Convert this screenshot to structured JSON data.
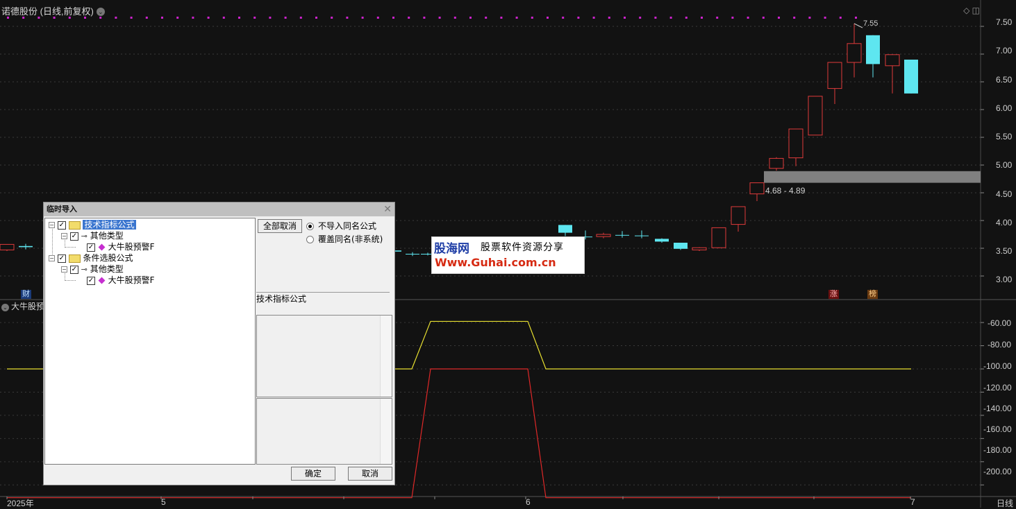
{
  "stock": {
    "title": "诺德股份 (日线,前复权)",
    "dropdown_glyph": "⌄"
  },
  "top_icons": [
    "◇",
    "◫"
  ],
  "price_axis": [
    "7.50",
    "7.00",
    "6.50",
    "6.00",
    "5.50",
    "5.00",
    "4.50",
    "4.00",
    "3.50",
    "3.00"
  ],
  "indicator": {
    "title": "大牛股预"
  },
  "indicator_axis": [
    "-60.00",
    "-80.00",
    "-100.00",
    "-120.00",
    "-140.00",
    "-160.00",
    "-180.00",
    "-200.00"
  ],
  "x_axis": {
    "labels": [
      "2025年",
      "5",
      "6",
      "7"
    ],
    "period": "日线"
  },
  "badges": {
    "cai": "财",
    "zhang": "涨",
    "bang": "榜"
  },
  "annotations": {
    "peak": "7.55",
    "range": "4.68 - 4.89"
  },
  "colors": {
    "up": "#e03a3a",
    "down": "#5ee6f0",
    "yellow_line": "#e8e030",
    "red_line": "#e02828",
    "magenta_dots": "#cc22cc",
    "band": "#808080"
  },
  "chart_data": {
    "type": "candlestick",
    "price_range": [
      2.75,
      7.75
    ],
    "candles": [
      {
        "o": 3.47,
        "c": 3.57,
        "h": 3.57,
        "l": 3.45,
        "dir": "up"
      },
      {
        "o": 3.54,
        "c": 3.52,
        "h": 3.58,
        "l": 3.48,
        "dir": "down"
      },
      {
        "o": 3.44,
        "c": 3.46,
        "h": 3.46,
        "l": 3.4,
        "dir": "down"
      },
      {
        "o": 3.4,
        "c": 3.39,
        "h": 3.43,
        "l": 3.36,
        "dir": "down"
      },
      {
        "o": 3.4,
        "c": 3.39,
        "h": 3.42,
        "l": 3.37,
        "dir": "down"
      },
      {
        "o": 3.92,
        "c": 3.78,
        "h": 3.92,
        "l": 3.72,
        "dir": "down"
      },
      {
        "o": 3.71,
        "c": 3.7,
        "h": 3.82,
        "l": 3.66,
        "dir": "down"
      },
      {
        "o": 3.71,
        "c": 3.75,
        "h": 3.78,
        "l": 3.68,
        "dir": "up"
      },
      {
        "o": 3.74,
        "c": 3.73,
        "h": 3.81,
        "l": 3.69,
        "dir": "down"
      },
      {
        "o": 3.73,
        "c": 3.72,
        "h": 3.82,
        "l": 3.68,
        "dir": "down"
      },
      {
        "o": 3.67,
        "c": 3.62,
        "h": 3.68,
        "l": 3.6,
        "dir": "down"
      },
      {
        "o": 3.6,
        "c": 3.49,
        "h": 3.6,
        "l": 3.47,
        "dir": "down"
      },
      {
        "o": 3.47,
        "c": 3.51,
        "h": 3.52,
        "l": 3.45,
        "dir": "up"
      },
      {
        "o": 3.51,
        "c": 3.87,
        "h": 3.87,
        "l": 3.5,
        "dir": "up"
      },
      {
        "o": 3.93,
        "c": 4.25,
        "h": 4.25,
        "l": 3.8,
        "dir": "up"
      },
      {
        "o": 4.48,
        "c": 4.68,
        "h": 4.68,
        "l": 4.35,
        "dir": "up"
      },
      {
        "o": 4.94,
        "c": 5.12,
        "h": 5.14,
        "l": 4.9,
        "dir": "up"
      },
      {
        "o": 5.13,
        "c": 5.65,
        "h": 5.65,
        "l": 4.98,
        "dir": "up"
      },
      {
        "o": 5.54,
        "c": 6.24,
        "h": 6.24,
        "l": 5.54,
        "dir": "up"
      },
      {
        "o": 6.38,
        "c": 6.85,
        "h": 6.85,
        "l": 6.1,
        "dir": "up"
      },
      {
        "o": 6.85,
        "c": 7.19,
        "h": 7.55,
        "l": 6.58,
        "dir": "up"
      },
      {
        "o": 7.34,
        "c": 6.82,
        "h": 7.34,
        "l": 6.58,
        "dir": "down"
      },
      {
        "o": 6.79,
        "c": 6.99,
        "h": 6.99,
        "l": 6.29,
        "dir": "up"
      },
      {
        "o": 6.9,
        "c": 6.29,
        "h": 6.9,
        "l": 6.29,
        "dir": "down"
      }
    ],
    "band": {
      "low": 4.68,
      "high": 4.89
    },
    "indicator_range": [
      -210,
      -45
    ],
    "indicator_lines": {
      "yellow": {
        "base": -100,
        "peak": -59
      },
      "red": {
        "base": -211,
        "peak": -100
      }
    }
  },
  "dialog": {
    "title": "临时导入",
    "close": "✕",
    "tree": {
      "group1": "技术指标公式",
      "group1_sub": "其他类型",
      "group1_item": "大牛股预警F",
      "group2": "条件选股公式",
      "group2_sub": "其他类型",
      "group2_item": "大牛股预警F"
    },
    "deselect_all": "全部取消",
    "options": [
      "不导入同名公式",
      "覆盖同名(非系统)"
    ],
    "section": "技术指标公式",
    "ok": "确定",
    "cancel": "取消"
  },
  "watermark": {
    "brand": "股海网",
    "tagline": "股票软件资源分享",
    "url": "Www.Guhai.com.cn"
  }
}
